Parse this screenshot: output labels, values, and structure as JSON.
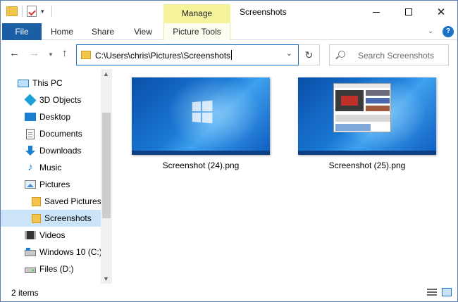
{
  "title_bar": {
    "contextual_tab": "Manage",
    "window_title": "Screenshots"
  },
  "ribbon": {
    "tabs": [
      {
        "label": "File"
      },
      {
        "label": "Home"
      },
      {
        "label": "Share"
      },
      {
        "label": "View"
      },
      {
        "label": "Picture Tools"
      }
    ],
    "help_label": "?"
  },
  "address_bar": {
    "path": "C:\\Users\\chris\\Pictures\\Screenshots"
  },
  "search": {
    "placeholder": "Search Screenshots"
  },
  "sidebar": {
    "items": [
      {
        "label": "This PC",
        "icon": "computer-icon"
      },
      {
        "label": "3D Objects",
        "icon": "3d-objects-icon"
      },
      {
        "label": "Desktop",
        "icon": "desktop-icon"
      },
      {
        "label": "Documents",
        "icon": "documents-icon"
      },
      {
        "label": "Downloads",
        "icon": "downloads-icon"
      },
      {
        "label": "Music",
        "icon": "music-icon"
      },
      {
        "label": "Pictures",
        "icon": "pictures-icon"
      },
      {
        "label": "Saved Pictures",
        "icon": "folder-icon"
      },
      {
        "label": "Screenshots",
        "icon": "folder-icon",
        "selected": true
      },
      {
        "label": "Videos",
        "icon": "videos-icon"
      },
      {
        "label": "Windows 10 (C:)",
        "icon": "drive-icon"
      },
      {
        "label": "Files (D:)",
        "icon": "drive-icon"
      }
    ]
  },
  "files": [
    {
      "name": "Screenshot (24).png"
    },
    {
      "name": "Screenshot (25).png"
    }
  ],
  "status": {
    "item_count": "2 items"
  },
  "colors": {
    "file_tab": "#1a5ea6",
    "manage_tab": "#f5f49c",
    "selection": "#cce4f7",
    "accent": "#1a73c9"
  }
}
